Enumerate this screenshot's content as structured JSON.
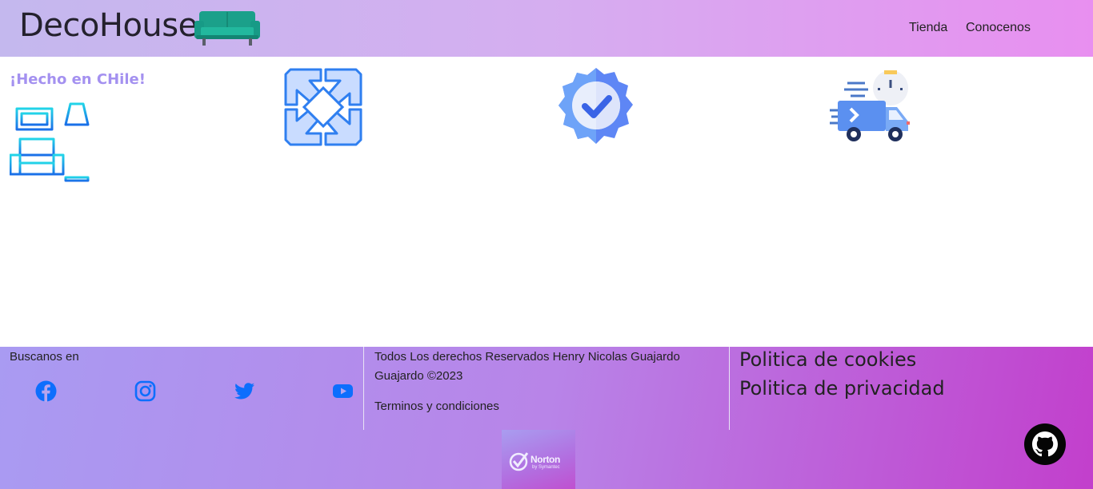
{
  "navbar": {
    "brand": "DecoHouse",
    "brand_icon": "sofa-icon",
    "links": [
      "Tienda",
      "Conocenos"
    ]
  },
  "features": {
    "tagline": "¡Hecho en CHile!",
    "icons": [
      "living-room-icon",
      "teamwork-hands-icon",
      "verified-badge-icon",
      "fast-delivery-truck-icon"
    ]
  },
  "footer": {
    "social_label": "Buscanos en",
    "social_icons": [
      "facebook-icon",
      "instagram-icon",
      "twitter-icon",
      "youtube-icon"
    ],
    "rights": "Todos Los derechos Reservados Henry Nicolas Guajardo Guajardo ©2023",
    "terms": "Terminos y condiciones",
    "policies": [
      "Politica de cookies",
      "Politica de privacidad"
    ],
    "norton": {
      "name": "Norton",
      "sub": "by Symantec"
    },
    "github_icon": "github-icon"
  },
  "colors": {
    "nav_gradient": [
      "#c4b8ee",
      "#e88ff0"
    ],
    "footer_gradient": [
      "#a99bf2",
      "#c23fcc"
    ],
    "tagline": "#a491f0",
    "social_blue": "#0d6efd"
  }
}
